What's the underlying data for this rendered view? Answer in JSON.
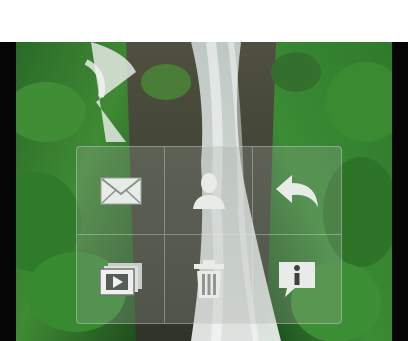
{
  "viewer": {
    "background": "#050505"
  },
  "menu": {
    "items": [
      {
        "icon": "envelope-icon",
        "action": "email"
      },
      {
        "icon": "person-icon",
        "action": "assign-to-contact"
      },
      {
        "icon": "reply-arrow-icon",
        "action": "back"
      },
      {
        "icon": "slideshow-icon",
        "action": "slideshow"
      },
      {
        "icon": "trash-icon",
        "action": "delete"
      },
      {
        "icon": "info-bubble-icon",
        "action": "info"
      }
    ],
    "icon_color": "#e8ece8"
  }
}
